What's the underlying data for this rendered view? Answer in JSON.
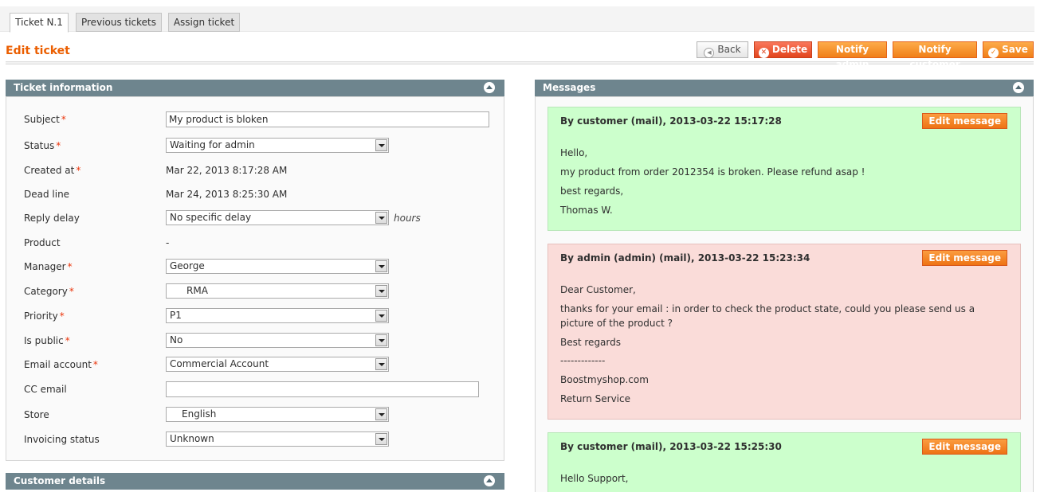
{
  "tabs": [
    "Ticket N.1",
    "Previous tickets",
    "Assign ticket"
  ],
  "page": {
    "title": "Edit ticket"
  },
  "actions": {
    "back": "Back",
    "delete": "Delete",
    "notify_admin": "Notify admin",
    "notify_customer": "Notify customer",
    "save": "Save"
  },
  "ticket_info": {
    "header": "Ticket information",
    "fields": {
      "subject": {
        "label": "Subject",
        "value": "My product is bloken"
      },
      "status": {
        "label": "Status",
        "value": "Waiting for admin"
      },
      "created_at": {
        "label": "Created at",
        "value": "Mar 22, 2013 8:17:28 AM"
      },
      "dead_line": {
        "label": "Dead line",
        "value": "Mar 24, 2013 8:25:30 AM"
      },
      "reply_delay": {
        "label": "Reply delay",
        "value": "No specific delay",
        "unit": "hours"
      },
      "product": {
        "label": "Product",
        "value": "-"
      },
      "manager": {
        "label": "Manager",
        "value": "George"
      },
      "category": {
        "label": "Category",
        "value": "RMA"
      },
      "priority": {
        "label": "Priority",
        "value": "P1"
      },
      "is_public": {
        "label": "Is public",
        "value": "No"
      },
      "email_account": {
        "label": "Email account",
        "value": "Commercial Account"
      },
      "cc_email": {
        "label": "CC email",
        "value": ""
      },
      "store": {
        "label": "Store",
        "value": "English"
      },
      "invoicing_status": {
        "label": "Invoicing status",
        "value": "Unknown"
      }
    },
    "required_marker": "*"
  },
  "customer_details": {
    "header": "Customer details"
  },
  "messages": {
    "header": "Messages",
    "edit_label": "Edit message",
    "items": [
      {
        "author": "By customer (mail), 2013-03-22 15:17:28",
        "lines": [
          "Hello,",
          "my product from order 2012354 is broken. Please refund asap !",
          "best regards,",
          "Thomas W."
        ]
      },
      {
        "author": "By admin (admin) (mail), 2013-03-22 15:23:34",
        "lines": [
          "Dear Customer,",
          "thanks for your email : in order to check the product state, could you please send us a picture of the product ?",
          "Best regards",
          "-------------",
          "Boostmyshop.com",
          "Return Service"
        ]
      },
      {
        "author": "By customer (mail), 2013-03-22 15:25:30",
        "lines": [
          "Hello Support,"
        ]
      }
    ]
  },
  "colors": {
    "accent": "#eb5e00",
    "panel_header": "#6e858e",
    "customer_message": "#ccffcc",
    "admin_message": "#fadcd9",
    "button_orange": "#f07f18"
  },
  "icons": {
    "back": "arrow-left-icon",
    "delete": "delete-circle-icon",
    "save": "checkmark-icon",
    "collapse": "collapse-up-icon",
    "dropdown": "chevron-down-icon"
  }
}
